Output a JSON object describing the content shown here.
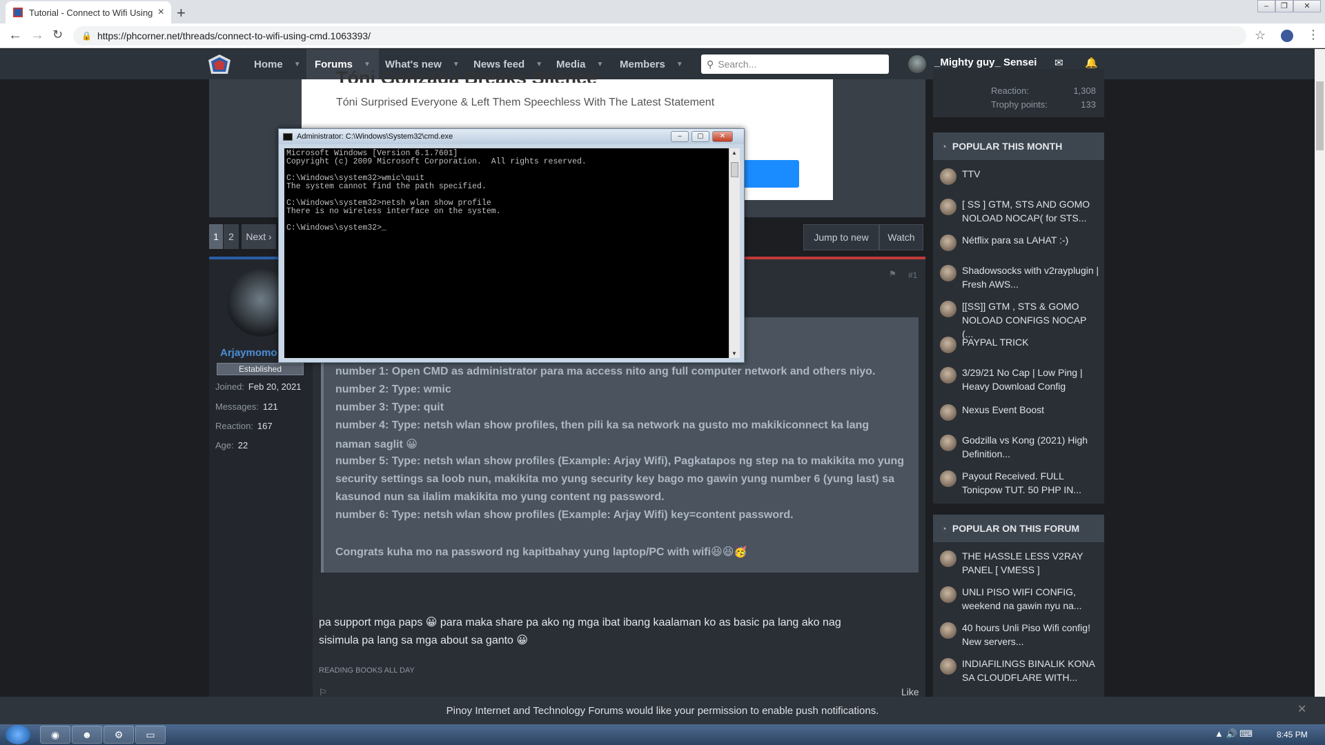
{
  "browser": {
    "tab_title": "Tutorial - Connect to Wifi Using",
    "url": "https://phcorner.net/threads/connect-to-wifi-using-cmd.1063393/"
  },
  "nav": {
    "items": [
      "Home",
      "Forums",
      "What's new",
      "News feed",
      "Media",
      "Members"
    ],
    "search_placeholder": "Search...",
    "username": "_Mighty guy_ Sensei"
  },
  "ad": {
    "title": "Tóni Gonzaga Breaks Silence",
    "subtitle": "Tóni Surprised Everyone & Left Them Speechless With The Latest Statement"
  },
  "pagination": {
    "pages": [
      "1",
      "2"
    ],
    "next": "Next ›"
  },
  "actions": {
    "jump": "Jump to new",
    "watch": "Watch"
  },
  "post": {
    "number": "#1",
    "username": "Arjaymomo",
    "badge": "Established",
    "stats": [
      {
        "label": "Joined:",
        "value": "Feb 20, 2021"
      },
      {
        "label": "Messages:",
        "value": "121"
      },
      {
        "label": "Reaction:",
        "value": "167"
      },
      {
        "label": "Age:",
        "value": "22"
      }
    ],
    "quote_lines": [
      "number 1: Open CMD as administrator para ma access nito ang full computer network and others niyo.",
      "number 2: Type: wmic",
      "number 3: Type: quit",
      "number 4: Type: netsh wlan show profiles, then pili ka sa network na gusto mo makikiconnect ka lang",
      "naman saglit 😀",
      "number 5: Type: netsh wlan show profiles (Example: Arjay Wifi), Pagkatapos ng step na to makikita mo yung",
      "security settings sa loob nun, makikita mo yung security key bago mo gawin yung number 6 (yung last) sa",
      "kasunod nun sa ilalim makikita mo yung content ng password.",
      "number 6: Type: netsh wlan show profiles (Example: Arjay Wifi) key=content password.",
      "",
      "Congrats kuha mo na password ng kapitbahay yung laptop/PC with wifi😆😆🥳"
    ],
    "body_lines": [
      "pa support mga paps 😀 para maka share pa ako ng mga ibat ibang kaalaman ko as basic pa lang ako nag",
      "sisimula pa lang sa mga about sa ganto 😀"
    ],
    "signature": "READING BOOKS ALL DAY",
    "like": "Like"
  },
  "sidebar": {
    "stats": [
      {
        "label": "Reaction:",
        "value": "1,308"
      },
      {
        "label": "Trophy points:",
        "value": "133"
      }
    ],
    "popular_month": {
      "title": "POPULAR THIS MONTH",
      "items": [
        "TTV",
        "[ SS ] GTM, STS AND GOMO NOLOAD NOCAP( for STS...",
        "Nétflix para sa LAHAT :-)",
        "Shadowsocks with v2rayplugin | Fresh AWS...",
        "[[SS]] GTM , STS & GOMO NOLOAD CONFIGS NOCAP (...",
        "PAYPAL TRICK",
        "3/29/21 No Cap | Low Ping | Heavy Download Config",
        "Nexus Event Boost",
        "Godzilla vs Kong (2021) High Definition...",
        "Payout Received. FULL Tonicpow TUT. 50 PHP IN..."
      ]
    },
    "popular_forum": {
      "title": "POPULAR ON THIS FORUM",
      "items": [
        "THE HASSLE LESS V2RAY PANEL [ VMESS ]",
        "UNLI PISO WIFI CONFIG, weekend na gawin nyu na...",
        "40 hours Unli Piso Wifi config! New servers...",
        "INDIAFILINGS BINALIK KONA SA CLOUDFLARE WITH..."
      ]
    }
  },
  "notification": "Pinoy Internet and Technology Forums would like your permission to enable push notifications.",
  "taskbar": {
    "clock": "8:45 PM"
  },
  "cmd": {
    "title": "Administrator: C:\\Windows\\System32\\cmd.exe",
    "lines": [
      "Microsoft Windows [Version 6.1.7601]",
      "Copyright (c) 2009 Microsoft Corporation.  All rights reserved.",
      "",
      "C:\\Windows\\system32>wmic\\quit",
      "The system cannot find the path specified.",
      "",
      "C:\\Windows\\system32>netsh wlan show profile",
      "There is no wireless interface on the system.",
      "",
      "C:\\Windows\\system32>_"
    ]
  },
  "colors": {
    "accent_blue": "#4c8fd9",
    "accent_red": "#c23a3a",
    "header_bg": "#2d333b"
  }
}
